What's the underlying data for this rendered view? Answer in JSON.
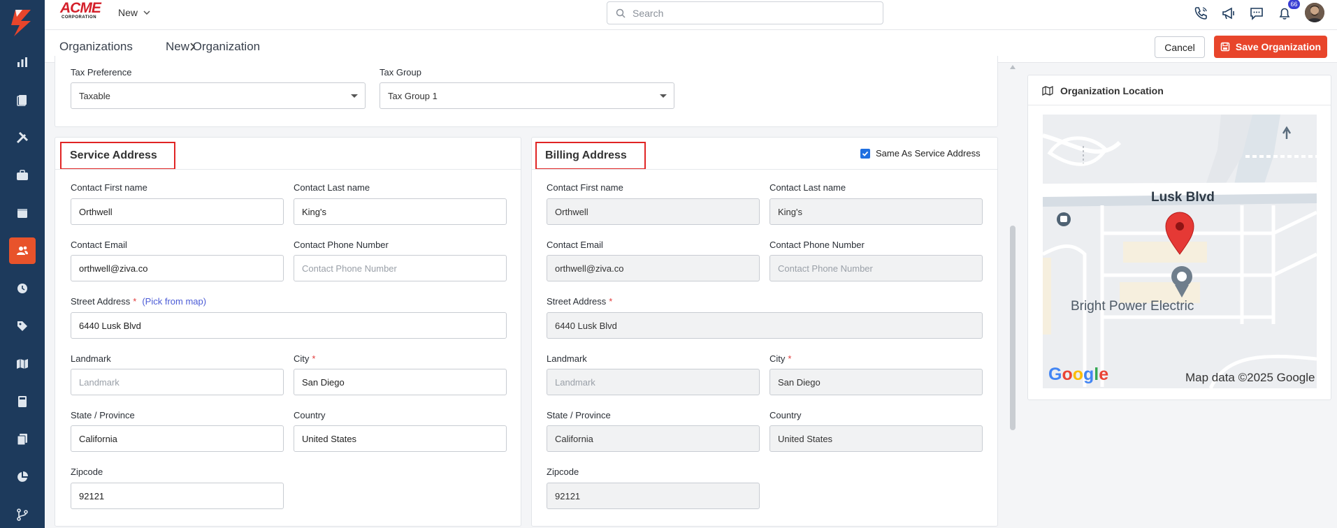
{
  "brand": {
    "name": "ACME",
    "sub": "CORPORATION"
  },
  "topbar": {
    "new_label": "New",
    "search_placeholder": "Search",
    "notification_count": "66"
  },
  "breadcrumb": {
    "root": "Organizations",
    "current": "New Organization"
  },
  "actions": {
    "cancel": "Cancel",
    "save": "Save Organization"
  },
  "tax": {
    "preference_label": "Tax Preference",
    "preference_value": "Taxable",
    "group_label": "Tax Group",
    "group_value": "Tax Group 1"
  },
  "service": {
    "title": "Service Address",
    "first_name_label": "Contact First name",
    "first_name": "Orthwell",
    "last_name_label": "Contact Last name",
    "last_name": "King's",
    "email_label": "Contact Email",
    "email": "orthwell@ziva.co",
    "phone_label": "Contact Phone Number",
    "phone_placeholder": "Contact Phone Number",
    "street_label": "Street Address",
    "pick_from_map": "(Pick from map)",
    "street": "6440 Lusk Blvd",
    "landmark_label": "Landmark",
    "landmark_placeholder": "Landmark",
    "city_label": "City",
    "city": "San Diego",
    "state_label": "State / Province",
    "state": "California",
    "country_label": "Country",
    "country": "United States",
    "zip_label": "Zipcode",
    "zip": "92121"
  },
  "billing": {
    "title": "Billing Address",
    "same_as_label": "Same As Service Address",
    "same_as_checked": true,
    "first_name_label": "Contact First name",
    "first_name": "Orthwell",
    "last_name_label": "Contact Last name",
    "last_name": "King's",
    "email_label": "Contact Email",
    "email": "orthwell@ziva.co",
    "phone_label": "Contact Phone Number",
    "phone_placeholder": "Contact Phone Number",
    "street_label": "Street Address",
    "street": "6440 Lusk Blvd",
    "landmark_label": "Landmark",
    "landmark_placeholder": "Landmark",
    "city_label": "City",
    "city": "San Diego",
    "state_label": "State / Province",
    "state": "California",
    "country_label": "Country",
    "country": "United States",
    "zip_label": "Zipcode",
    "zip": "92121"
  },
  "location": {
    "title": "Organization Location",
    "street_name": "Lusk Blvd",
    "place_name": "Bright Power Electric",
    "google": "Google",
    "attribution": "Map data ©2025 Google"
  },
  "colors": {
    "accent": "#e8452b",
    "sidebar": "#1d3a5c",
    "highlight": "#e02424",
    "checkbox": "#1f6fe0"
  }
}
